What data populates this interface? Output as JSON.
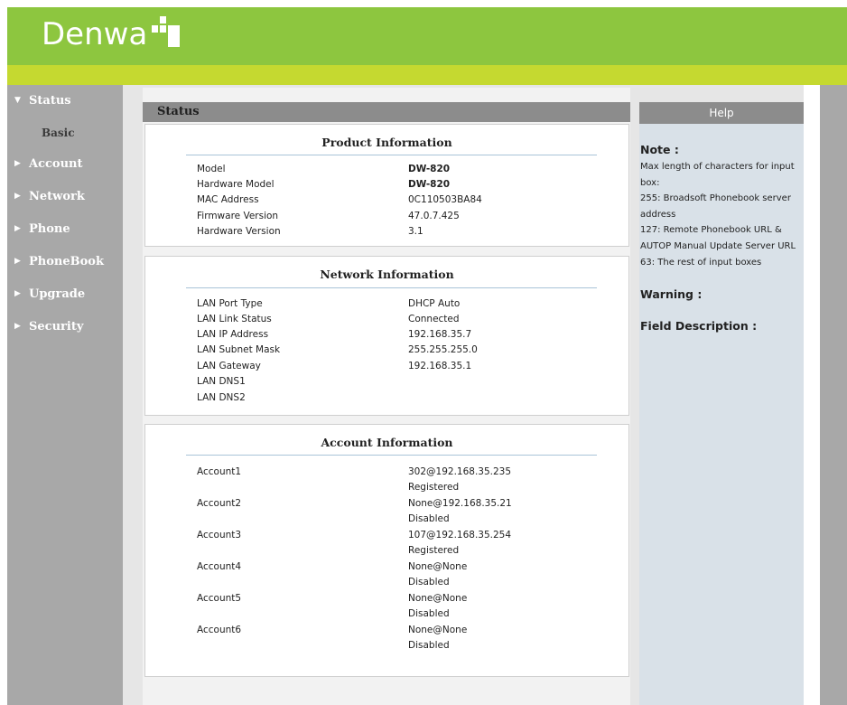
{
  "brand": {
    "name": "Denwa",
    "color": "#8dc63f",
    "stripe_color": "#c5d930"
  },
  "sidebar": {
    "items": [
      {
        "label": "Status",
        "expanded": true
      },
      {
        "label": "Account",
        "expanded": false
      },
      {
        "label": "Network",
        "expanded": false
      },
      {
        "label": "Phone",
        "expanded": false
      },
      {
        "label": "PhoneBook",
        "expanded": false
      },
      {
        "label": "Upgrade",
        "expanded": false
      },
      {
        "label": "Security",
        "expanded": false
      }
    ],
    "sub_items": [
      {
        "label": "Basic",
        "parent": "Status",
        "selected": true
      }
    ],
    "expanded_icon": "triangle-down-icon",
    "collapsed_icon": "triangle-right-icon"
  },
  "page": {
    "title": "Status"
  },
  "product": {
    "title": "Product Information",
    "rows": [
      {
        "label": "Model",
        "value": "DW-820"
      },
      {
        "label": "Hardware Model",
        "value": "DW-820"
      },
      {
        "label": "MAC Address",
        "value": "0C110503BA84"
      },
      {
        "label": "Firmware Version",
        "value": "47.0.7.425"
      },
      {
        "label": "Hardware Version",
        "value": "3.1"
      }
    ]
  },
  "network": {
    "title": "Network Information",
    "rows": [
      {
        "label": "LAN Port Type",
        "value": "DHCP Auto"
      },
      {
        "label": "LAN Link Status",
        "value": "Connected"
      },
      {
        "label": "LAN IP Address",
        "value": "192.168.35.7"
      },
      {
        "label": "LAN Subnet Mask",
        "value": "255.255.255.0"
      },
      {
        "label": "LAN Gateway",
        "value": "192.168.35.1"
      },
      {
        "label": "LAN DNS1",
        "value": ""
      },
      {
        "label": "LAN DNS2",
        "value": ""
      }
    ]
  },
  "accounts": {
    "title": "Account Information",
    "rows": [
      {
        "label": "Account1",
        "address": "302@192.168.35.235",
        "status": "Registered"
      },
      {
        "label": "Account2",
        "address": "None@192.168.35.21",
        "status": "Disabled"
      },
      {
        "label": "Account3",
        "address": "107@192.168.35.254",
        "status": "Registered"
      },
      {
        "label": "Account4",
        "address": "None@None",
        "status": "Disabled"
      },
      {
        "label": "Account5",
        "address": "None@None",
        "status": "Disabled"
      },
      {
        "label": "Account6",
        "address": "None@None",
        "status": "Disabled"
      }
    ]
  },
  "help": {
    "title": "Help",
    "note_heading": "Note :",
    "note_lines": [
      "Max length of characters for input",
      "box:",
      "255: Broadsoft Phonebook server",
      "address",
      "127: Remote Phonebook URL &",
      "AUTOP Manual Update Server URL",
      "63: The rest of input boxes"
    ],
    "warning_heading": "Warning :",
    "field_heading": "Field Description :"
  }
}
